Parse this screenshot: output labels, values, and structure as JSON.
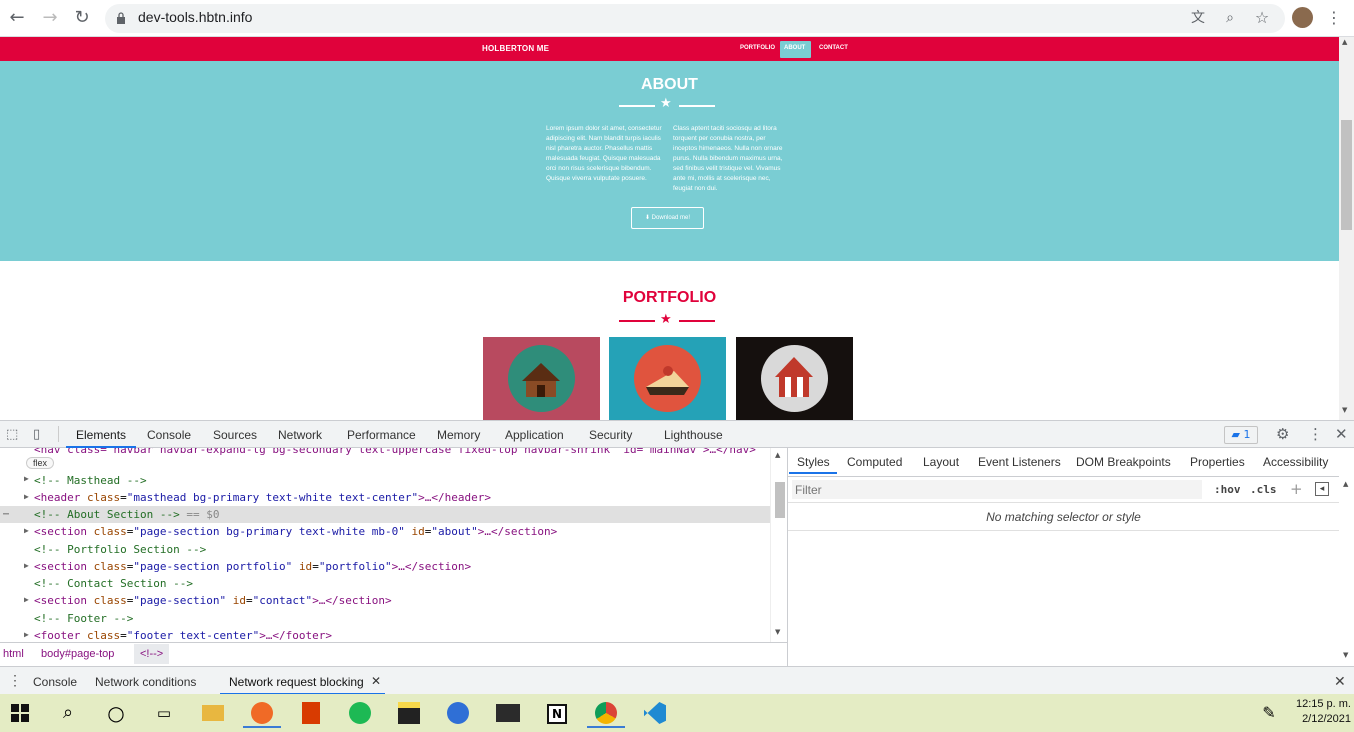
{
  "browser": {
    "url": "dev-tools.hbtn.info"
  },
  "site": {
    "brand": "HOLBERTON ME",
    "nav": [
      "PORTFOLIO",
      "ABOUT",
      "CONTACT"
    ],
    "about_title": "ABOUT",
    "about_left": "Lorem ipsum dolor sit amet, consectetur adipiscing elit. Nam blandit turpis iaculis nisl pharetra auctor. Phasellus mattis malesuada feugiat. Quisque malesuada orci non risus scelerisque bibendum. Quisque viverra vulputate posuere.",
    "about_right": "Class aptent taciti sociosqu ad litora torquent per conubia nostra, per inceptos himenaeos. Nulla non ornare purus. Nulla bibendum maximus urna, sed finibus velit tristique vel. Vivamus ante mi, mollis at scelerisque nec, feugiat non dui.",
    "download": "Download me!",
    "portfolio_title": "PORTFOLIO",
    "colors": {
      "primary": "#7acdd3",
      "accent": "#e0023b"
    }
  },
  "devtools": {
    "tabs": [
      "Elements",
      "Console",
      "Sources",
      "Network",
      "Performance",
      "Memory",
      "Application",
      "Security",
      "Lighthouse"
    ],
    "badge": "1",
    "dom_lines": {
      "nav_partial": "<nav class=\"navbar navbar-expand-lg bg-secondary text-uppercase fixed-top navbar-shrink\" id=\"mainNav\">…</nav>",
      "flex": "flex",
      "l1": "<!-- Masthead -->",
      "l2_tag": "<header",
      "l2_attr": "class",
      "l2_val": "\"masthead bg-primary text-white text-center\"",
      "l2_end": ">…</header>",
      "l3": "<!-- About Section -->",
      "l3_sel": "== $0",
      "l4_tag": "<section",
      "l4_attr": "class",
      "l4_val": "\"page-section bg-primary text-white mb-0\"",
      "l4_attr2": "id",
      "l4_val2": "\"about\"",
      "l4_end": ">…</section>",
      "l5": "<!-- Portfolio Section -->",
      "l6_tag": "<section",
      "l6_attr": "class",
      "l6_val": "\"page-section portfolio\"",
      "l6_attr2": "id",
      "l6_val2": "\"portfolio\"",
      "l6_end": ">…</section>",
      "l7": "<!-- Contact Section -->",
      "l8_tag": "<section",
      "l8_attr": "class",
      "l8_val": "\"page-section\"",
      "l8_attr2": "id",
      "l8_val2": "\"contact\"",
      "l8_end": ">…</section>",
      "l9": "<!-- Footer -->",
      "l10_tag": "<footer",
      "l10_attr": "class",
      "l10_val": "\"footer text-center\"",
      "l10_end": ">…</footer>"
    },
    "breadcrumb": [
      "html",
      "body#page-top",
      "<!-->"
    ],
    "style_tabs": [
      "Styles",
      "Computed",
      "Layout",
      "Event Listeners",
      "DOM Breakpoints",
      "Properties",
      "Accessibility"
    ],
    "filter_placeholder": "Filter",
    "hov": ":hov",
    "cls": ".cls",
    "no_match": "No matching selector or style",
    "drawer_tabs": [
      "Console",
      "Network conditions",
      "Network request blocking"
    ]
  },
  "taskbar": {
    "time": "12:15 p. m.",
    "date": "2/12/2021"
  }
}
